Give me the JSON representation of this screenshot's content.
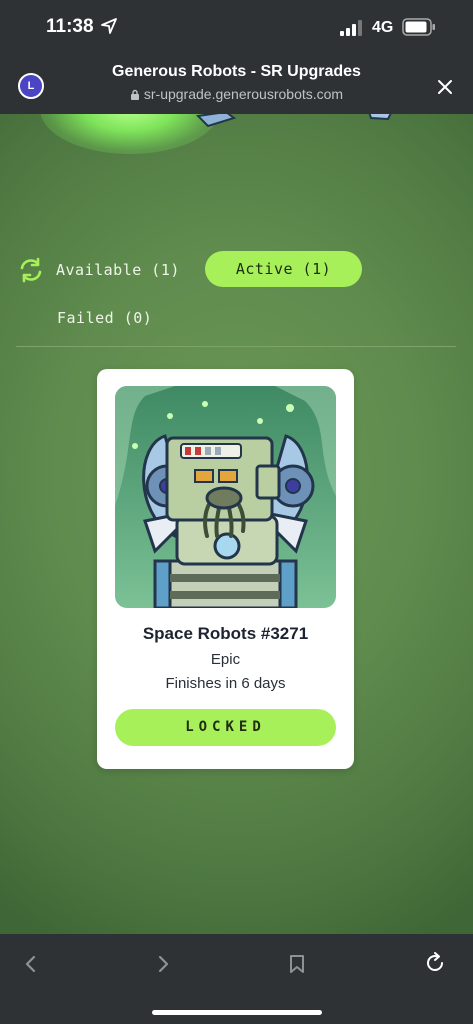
{
  "status_bar": {
    "time": "11:38",
    "network": "4G",
    "icons": [
      "location-arrow-icon",
      "signal-bars-icon",
      "battery-icon"
    ]
  },
  "browser": {
    "avatar_letter": "L",
    "page_title": "Generous Robots - SR Upgrades",
    "url": "sr-upgrade.generousrobots.com"
  },
  "filters": {
    "available": "Available (1)",
    "active": "Active (1)",
    "failed": "Failed (0)",
    "selected": "active"
  },
  "card": {
    "title": "Space Robots #3271",
    "rarity": "Epic",
    "eta": "Finishes in 6 days",
    "button": "LOCKED"
  },
  "colors": {
    "accent": "#a8f05a",
    "background": "#5f8b4e",
    "chrome": "#2f3234"
  }
}
